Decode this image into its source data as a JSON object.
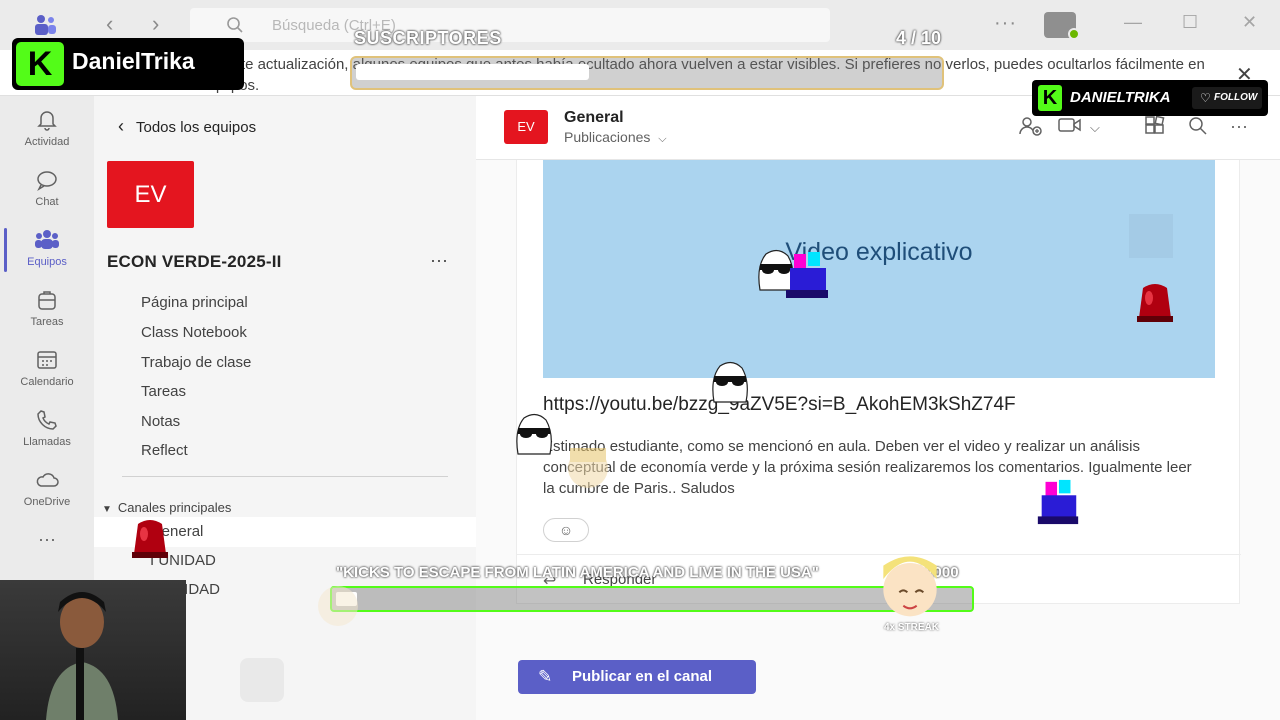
{
  "titlebar": {
    "search_placeholder": "Búsqueda (Ctrl+E)",
    "more": "···",
    "minimize": "—",
    "maximize": "☐",
    "close": "✕"
  },
  "banner": {
    "text": "de una reciente actualización, algunos equipos que antes había ocultado ahora vuelven a estar visibles. Si prefieres no verlos, puedes ocultarlos fácilmente en la vista Equipos.",
    "close": "✕"
  },
  "rail": {
    "items": [
      {
        "label": "Actividad",
        "icon": "bell-icon"
      },
      {
        "label": "Chat",
        "icon": "chat-icon"
      },
      {
        "label": "Equipos",
        "icon": "teams-icon",
        "active": true
      },
      {
        "label": "Tareas",
        "icon": "backpack-icon"
      },
      {
        "label": "Calendario",
        "icon": "calendar-icon"
      },
      {
        "label": "Llamadas",
        "icon": "phone-icon"
      },
      {
        "label": "OneDrive",
        "icon": "cloud-icon"
      }
    ],
    "more": "···"
  },
  "team": {
    "back_label": "Todos los equipos",
    "avatar_text": "EV",
    "name": "ECON VERDE-2025-II",
    "more": "···",
    "nav": [
      "Página principal",
      "Class Notebook",
      "Trabajo de clase",
      "Tareas",
      "Notas",
      "Reflect"
    ],
    "section_title": "Canales principales",
    "channels": [
      "General",
      "I UNIDAD",
      "II UNIDAD"
    ]
  },
  "channel": {
    "avatar_text": "EV",
    "title": "General",
    "subtitle": "Publicaciones"
  },
  "post": {
    "video_title": "Video explicativo",
    "link": "https://youtu.be/bzzg_9aZV5E?si=B_AkohEM3kShZ74F",
    "body": "Estimado estudiante, como se mencionó en aula. Deben ver el video y realizar un análisis conceptual de economía verde y la próxima sesión realizaremos los comentarios. Igualmente leer la cumbre de Paris.. Saludos",
    "reply_label": "Responder"
  },
  "publish_label": "Publicar en el canal",
  "overlay": {
    "brand_name": "DanielTrika",
    "subs_label": "SUSCRIPTORES",
    "subs_current": "4",
    "subs_goal": "10",
    "subs_count_text": "4 / 10",
    "subs_progress": 0.4,
    "follow_name": "DANIELTRIKA",
    "follow_label": "FOLLOW",
    "goal_label": "\"KICKS TO ESCAPE FROM LATIN AMERICA AND LIVE IN THE USA\"",
    "goal_count_text": "68 / 2000",
    "goal_progress": 0.034,
    "streak": "4x STREAK"
  },
  "colors": {
    "teams_purple": "#5b5fc7",
    "team_red": "#e4151f",
    "kick_green": "#53fc18",
    "video_blue": "#abd4ef"
  }
}
